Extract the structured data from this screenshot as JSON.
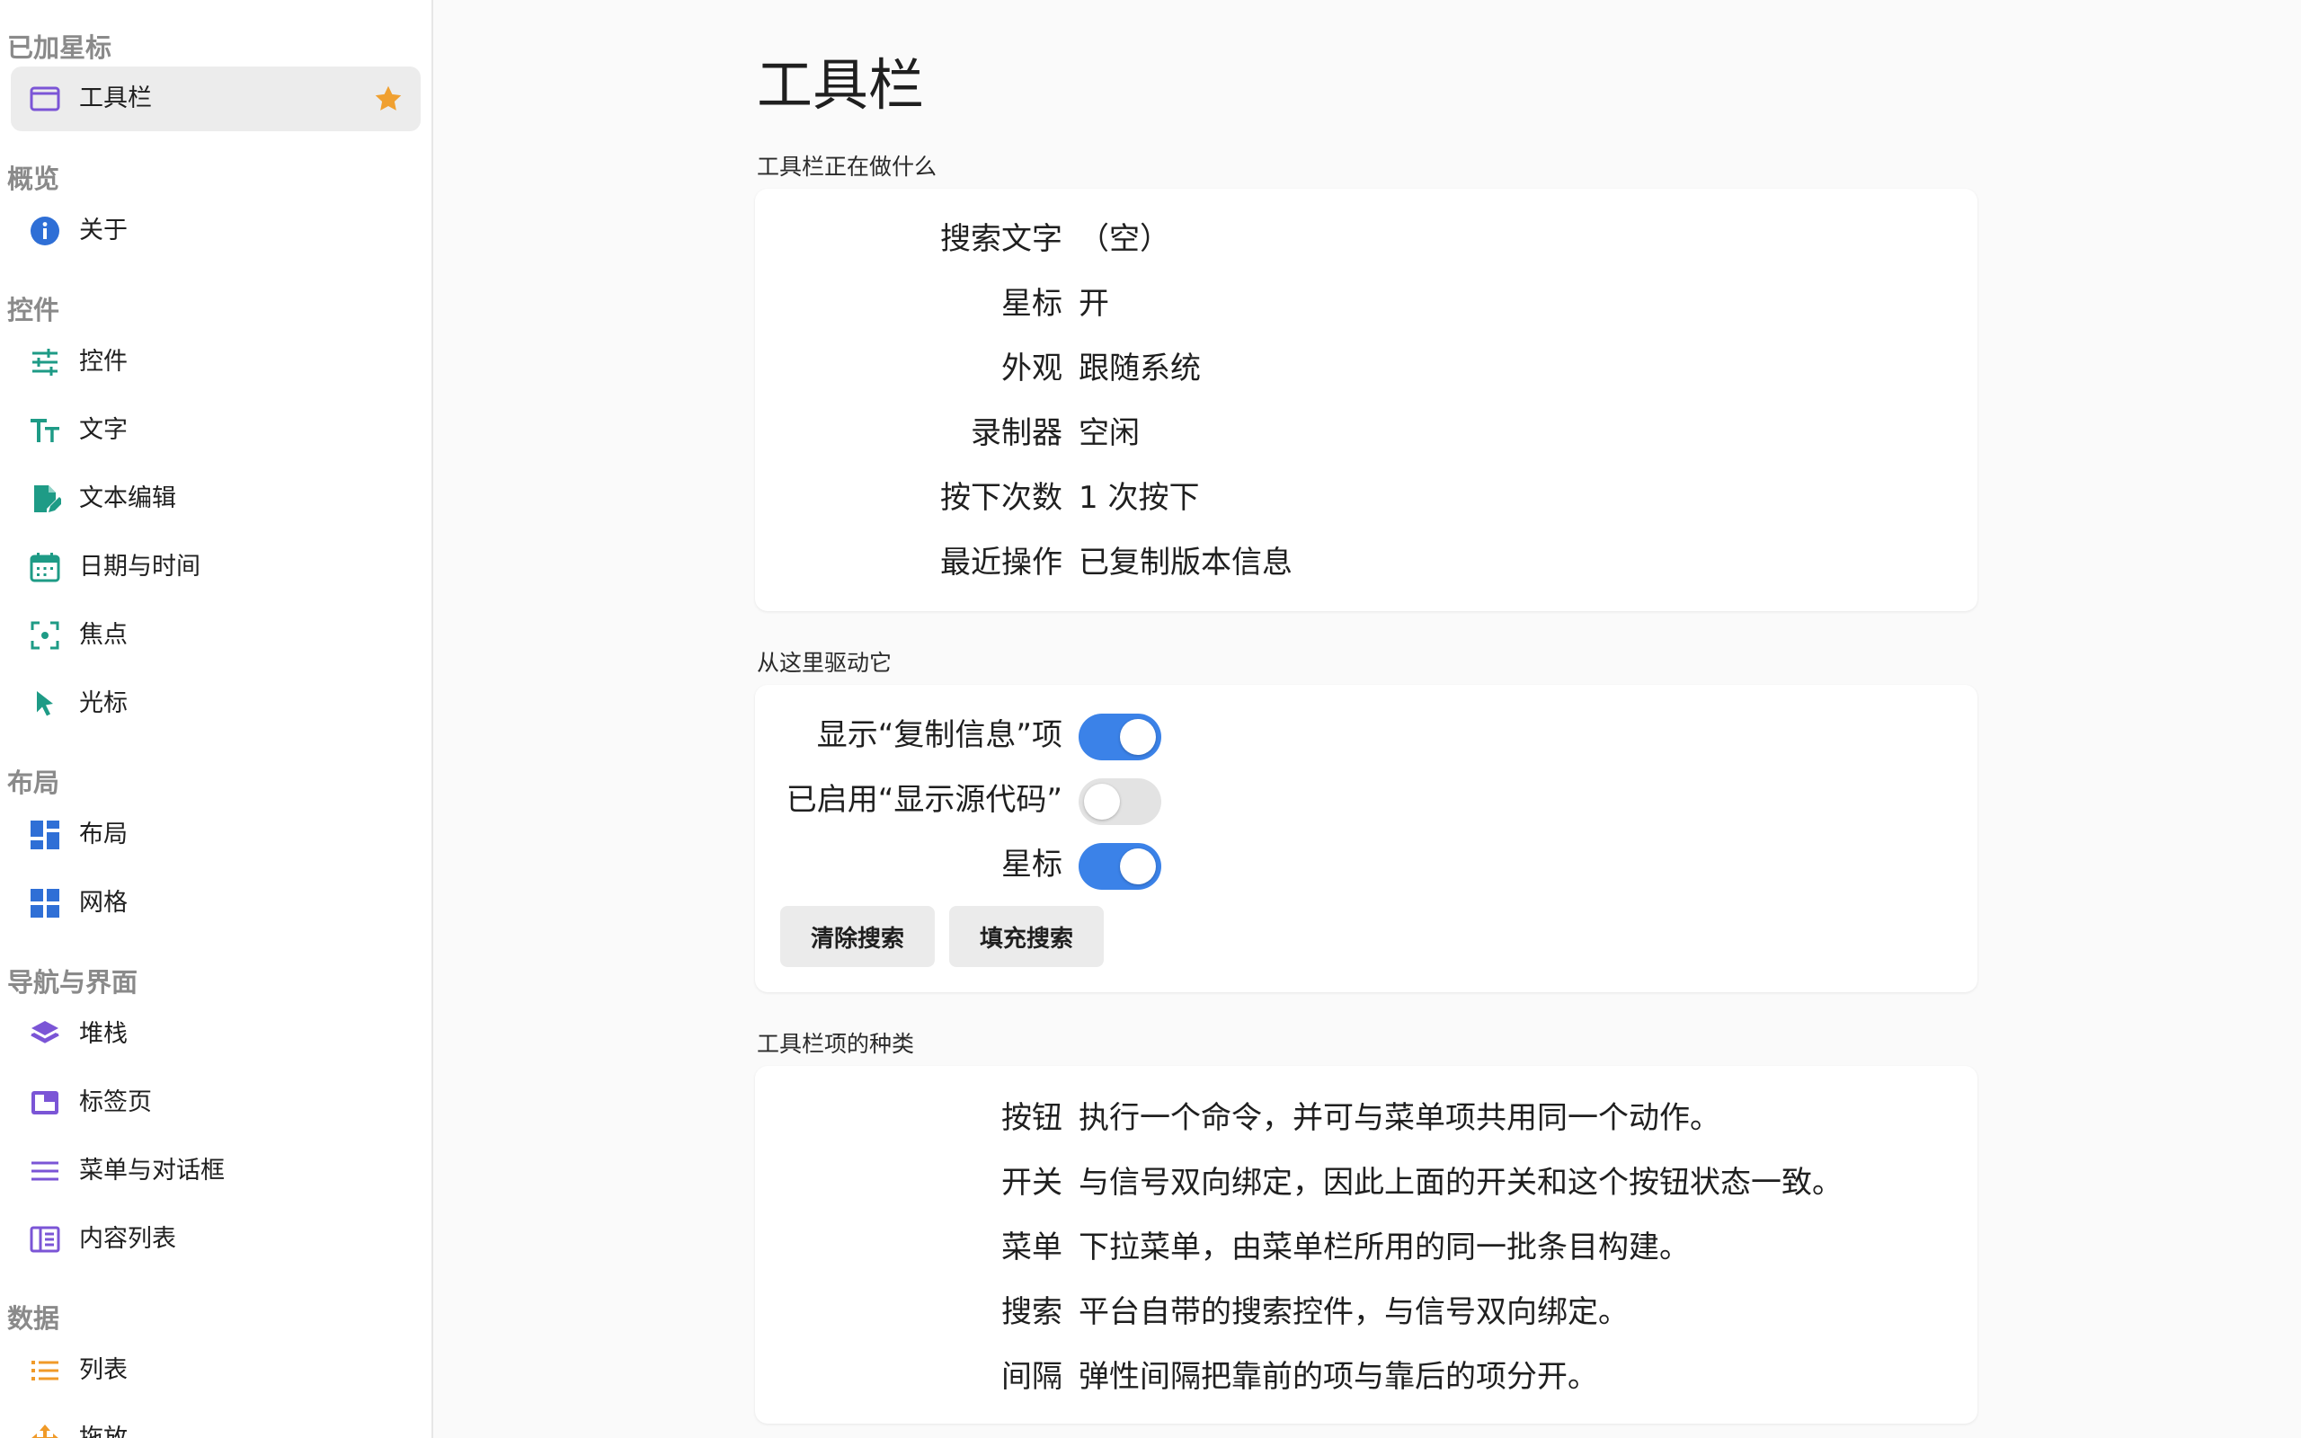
{
  "sidebar": {
    "sections": [
      {
        "title": "已加星标",
        "items": [
          {
            "label": "工具栏",
            "icon": "window-icon",
            "active": true,
            "starred": true
          }
        ]
      },
      {
        "title": "概览",
        "items": [
          {
            "label": "关于",
            "icon": "info-icon"
          }
        ]
      },
      {
        "title": "控件",
        "items": [
          {
            "label": "控件",
            "icon": "sliders-icon"
          },
          {
            "label": "文字",
            "icon": "text-icon"
          },
          {
            "label": "文本编辑",
            "icon": "edit-document-icon"
          },
          {
            "label": "日期与时间",
            "icon": "calendar-icon"
          },
          {
            "label": "焦点",
            "icon": "focus-icon"
          },
          {
            "label": "光标",
            "icon": "cursor-icon"
          }
        ]
      },
      {
        "title": "布局",
        "items": [
          {
            "label": "布局",
            "icon": "layout-icon"
          },
          {
            "label": "网格",
            "icon": "grid-icon"
          }
        ]
      },
      {
        "title": "导航与界面",
        "items": [
          {
            "label": "堆栈",
            "icon": "stack-icon"
          },
          {
            "label": "标签页",
            "icon": "tabs-icon"
          },
          {
            "label": "菜单与对话框",
            "icon": "menu-icon"
          },
          {
            "label": "内容列表",
            "icon": "content-list-icon"
          }
        ]
      },
      {
        "title": "数据",
        "items": [
          {
            "label": "列表",
            "icon": "list-icon"
          },
          {
            "label": "拖放",
            "icon": "drag-icon"
          }
        ]
      }
    ]
  },
  "main": {
    "title": "工具栏",
    "status": {
      "label": "工具栏正在做什么",
      "rows": [
        {
          "label": "搜索文字",
          "value": "（空）"
        },
        {
          "label": "星标",
          "value": "开"
        },
        {
          "label": "外观",
          "value": "跟随系统"
        },
        {
          "label": "录制器",
          "value": "空闲"
        },
        {
          "label": "按下次数",
          "value": "1 次按下"
        },
        {
          "label": "最近操作",
          "value": "已复制版本信息"
        }
      ]
    },
    "drive": {
      "label": "从这里驱动它",
      "toggles": [
        {
          "label": "显示“复制信息”项",
          "on": true
        },
        {
          "label": "已启用“显示源代码”",
          "on": false
        },
        {
          "label": "星标",
          "on": true
        }
      ],
      "buttons": {
        "clear": "清除搜索",
        "fill": "填充搜索"
      }
    },
    "kinds": {
      "label": "工具栏项的种类",
      "rows": [
        {
          "label": "按钮",
          "value": "执行一个命令，并可与菜单项共用同一个动作。"
        },
        {
          "label": "开关",
          "value": "与信号双向绑定，因此上面的开关和这个按钮状态一致。"
        },
        {
          "label": "菜单",
          "value": "下拉菜单，由菜单栏所用的同一批条目构建。"
        },
        {
          "label": "搜索",
          "value": "平台自带的搜索控件，与信号双向绑定。"
        },
        {
          "label": "间隔",
          "value": "弹性间隔把靠前的项与靠后的项分开。"
        }
      ]
    }
  },
  "colors": {
    "accent": "#3b82e8",
    "star": "#f0a030",
    "icon_green": "#1e9b86",
    "icon_blue": "#2f6fd6",
    "icon_purple": "#7b55d6",
    "icon_orange": "#f09a28"
  }
}
